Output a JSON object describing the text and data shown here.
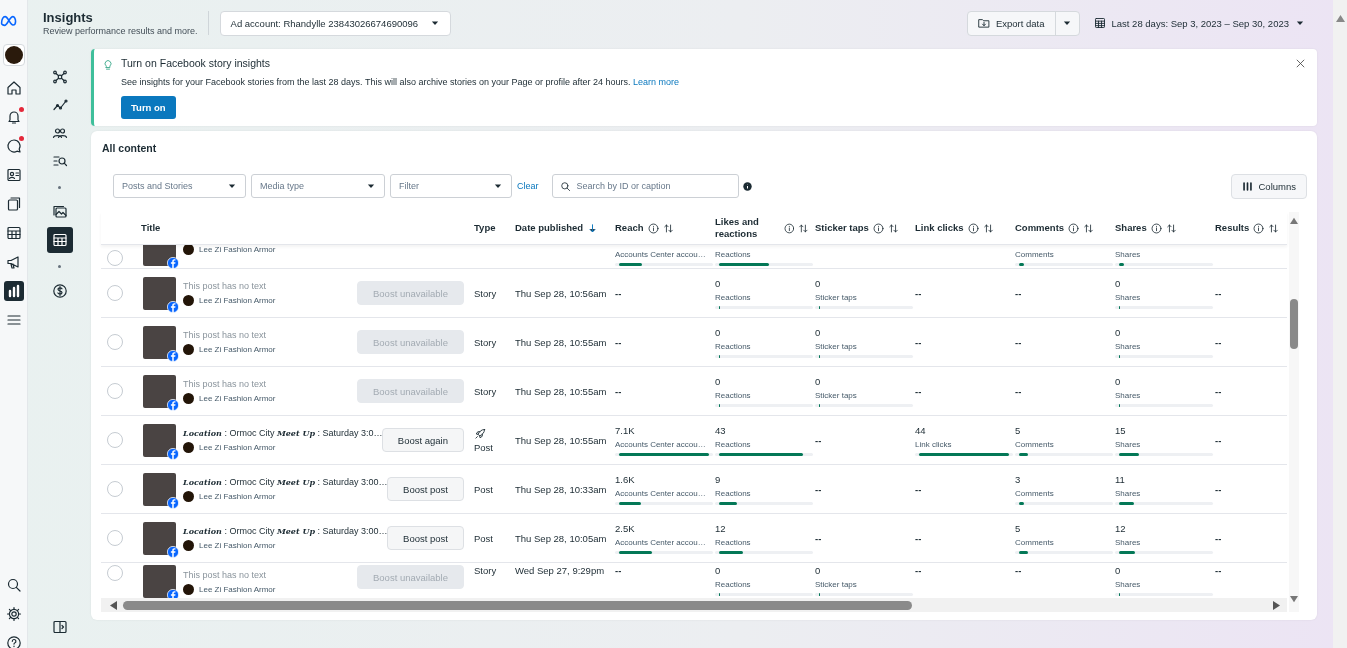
{
  "nav": {
    "items": [
      {
        "kind": "avatar",
        "selected": false,
        "badge": false
      },
      {
        "kind": "home",
        "selected": false,
        "badge": false
      },
      {
        "kind": "bell",
        "selected": false,
        "badge": true
      },
      {
        "kind": "chat",
        "selected": false,
        "badge": true
      },
      {
        "kind": "contact",
        "selected": false,
        "badge": false
      },
      {
        "kind": "pages",
        "selected": false,
        "badge": false
      },
      {
        "kind": "table",
        "selected": false,
        "badge": false
      },
      {
        "kind": "megaphone",
        "selected": false,
        "badge": false
      },
      {
        "kind": "chart",
        "selected": true,
        "badge": false
      },
      {
        "kind": "menu",
        "selected": false,
        "badge": false
      }
    ],
    "bottom_items": [
      {
        "kind": "search",
        "selected": false,
        "badge": false
      },
      {
        "kind": "settings",
        "selected": false,
        "badge": false
      },
      {
        "kind": "help",
        "selected": false,
        "badge": false
      }
    ]
  },
  "header": {
    "title": "Insights",
    "subtitle": "Review performance results and more.",
    "account": "Ad account: Rhandylle 23843026674690096",
    "export": "Export data",
    "date_range": "Last 28 days: Sep 3, 2023 – Sep 30, 2023"
  },
  "subnav": {
    "items": [
      {
        "kind": "nodes",
        "selected": false
      },
      {
        "kind": "trend",
        "selected": false
      },
      {
        "kind": "people",
        "selected": false
      },
      {
        "kind": "searchlist",
        "selected": false
      },
      {
        "kind": "dot"
      },
      {
        "kind": "gallery",
        "selected": false
      },
      {
        "kind": "table",
        "selected": true
      },
      {
        "kind": "dot"
      },
      {
        "kind": "dollar",
        "selected": false
      }
    ],
    "bottom_items": [
      {
        "kind": "panel",
        "selected": false
      }
    ]
  },
  "banner": {
    "title": "Turn on Facebook story insights",
    "text": "See insights for your Facebook stories from the last 28 days. This will also archive stories on your Page or profile after 24 hours.",
    "link": "Learn more",
    "button": "Turn on"
  },
  "content": {
    "title": "All content",
    "filters": [
      {
        "label": "Posts and Stories"
      },
      {
        "label": "Media type"
      },
      {
        "label": "Filter"
      }
    ],
    "clear": "Clear",
    "search": {
      "placeholder": "Search by ID or caption"
    },
    "columns_button": "Columns",
    "columns": [
      {
        "label": "Title",
        "info": false,
        "sortable": false,
        "sorted_desc": false
      },
      {
        "label": "Type",
        "info": false,
        "sortable": false,
        "sorted_desc": false
      },
      {
        "label": "Date published",
        "info": false,
        "sortable": false,
        "sorted_desc": true
      },
      {
        "label": "Reach",
        "info": true,
        "sortable": true,
        "sorted_desc": false
      },
      {
        "label": "Likes and reactions",
        "info": true,
        "sortable": true,
        "sorted_desc": false
      },
      {
        "label": "Sticker taps",
        "info": true,
        "sortable": true,
        "sorted_desc": false
      },
      {
        "label": "Link clicks",
        "info": true,
        "sortable": true,
        "sorted_desc": false
      },
      {
        "label": "Comments",
        "info": true,
        "sortable": true,
        "sorted_desc": false
      },
      {
        "label": "Shares",
        "info": true,
        "sortable": true,
        "sorted_desc": false
      },
      {
        "label": "Results",
        "info": true,
        "sortable": true,
        "sorted_desc": false
      }
    ],
    "rows": [
      {
        "partial": true,
        "author": "Lee Zi Fashion Armor",
        "metrics": {
          "reach": {
            "label": "Accounts Center accou…",
            "level": 0.25
          },
          "likes": {
            "label": "Reactions",
            "level": 0.55
          },
          "comments": {
            "label": "Comments",
            "level": 0.05
          },
          "shares": {
            "label": "Shares",
            "level": 0.06
          }
        }
      },
      {
        "partial": false,
        "title": "This post has no text",
        "title_muted": true,
        "author": "Lee Zi Fashion Armor",
        "boost": {
          "label": "Boost unavailable",
          "disabled": true
        },
        "type": "Story",
        "boosted": false,
        "date": "Thu Sep 28, 10:56am",
        "metrics": {
          "reach": {
            "value": "--"
          },
          "likes": {
            "value": "0",
            "label": "Reactions",
            "level": 0.01
          },
          "sticker_taps": {
            "value": "0",
            "label": "Sticker taps",
            "level": 0.01
          },
          "link_clicks": {
            "value": "--"
          },
          "comments": {
            "value": "--"
          },
          "shares": {
            "value": "0",
            "label": "Shares",
            "level": 0.01
          },
          "results": {
            "value": "--"
          }
        }
      },
      {
        "partial": false,
        "title": "This post has no text",
        "title_muted": true,
        "author": "Lee Zi Fashion Armor",
        "boost": {
          "label": "Boost unavailable",
          "disabled": true
        },
        "type": "Story",
        "boosted": false,
        "date": "Thu Sep 28, 10:55am",
        "metrics": {
          "reach": {
            "value": "--"
          },
          "likes": {
            "value": "0",
            "label": "Reactions",
            "level": 0.01
          },
          "sticker_taps": {
            "value": "0",
            "label": "Sticker taps",
            "level": 0.01
          },
          "link_clicks": {
            "value": "--"
          },
          "comments": {
            "value": "--"
          },
          "shares": {
            "value": "0",
            "label": "Shares",
            "level": 0.01
          },
          "results": {
            "value": "--"
          }
        }
      },
      {
        "partial": false,
        "title": "This post has no text",
        "title_muted": true,
        "author": "Lee Zi Fashion Armor",
        "boost": {
          "label": "Boost unavailable",
          "disabled": true
        },
        "type": "Story",
        "boosted": false,
        "date": "Thu Sep 28, 10:55am",
        "metrics": {
          "reach": {
            "value": "--"
          },
          "likes": {
            "value": "0",
            "label": "Reactions",
            "level": 0.01
          },
          "sticker_taps": {
            "value": "0",
            "label": "Sticker taps",
            "level": 0.01
          },
          "link_clicks": {
            "value": "--"
          },
          "comments": {
            "value": "--"
          },
          "shares": {
            "value": "0",
            "label": "Shares",
            "level": 0.01
          },
          "results": {
            "value": "--"
          }
        }
      },
      {
        "partial": false,
        "title": "**Location** : Ormoc City **Meet Up** : Saturday 3:0…",
        "title_muted": false,
        "author": "Lee Zi Fashion Armor",
        "boost": {
          "label": "Boost again",
          "disabled": false
        },
        "type": "Post",
        "boosted": true,
        "date": "Thu Sep 28, 10:55am",
        "metrics": {
          "reach": {
            "value": "7.1K",
            "label": "Accounts Center accou…",
            "level": 1
          },
          "likes": {
            "value": "43",
            "label": "Reactions",
            "level": 0.93
          },
          "sticker_taps": {
            "value": "--"
          },
          "link_clicks": {
            "value": "44",
            "label": "Link clicks",
            "level": 1
          },
          "comments": {
            "value": "5",
            "label": "Comments",
            "level": 0.1
          },
          "shares": {
            "value": "15",
            "label": "Shares",
            "level": 0.22
          },
          "results": {
            "value": "--"
          }
        }
      },
      {
        "partial": false,
        "title": "**Location** : Ormoc City **Meet Up** : Saturday 3:00…",
        "title_muted": false,
        "author": "Lee Zi Fashion Armor",
        "boost": {
          "label": "Boost post",
          "disabled": false
        },
        "type": "Post",
        "boosted": false,
        "date": "Thu Sep 28, 10:33am",
        "metrics": {
          "reach": {
            "value": "1.6K",
            "label": "Accounts Center accou…",
            "level": 0.24
          },
          "likes": {
            "value": "9",
            "label": "Reactions",
            "level": 0.2
          },
          "sticker_taps": {
            "value": "--"
          },
          "link_clicks": {
            "value": "--"
          },
          "comments": {
            "value": "3",
            "label": "Comments",
            "level": 0.06
          },
          "shares": {
            "value": "11",
            "label": "Shares",
            "level": 0.17
          },
          "results": {
            "value": "--"
          }
        }
      },
      {
        "partial": false,
        "title": "**Location** : Ormoc City **Meet Up** : Saturday 3:00…",
        "title_muted": false,
        "author": "Lee Zi Fashion Armor",
        "boost": {
          "label": "Boost post",
          "disabled": false
        },
        "type": "Post",
        "boosted": false,
        "date": "Thu Sep 28, 10:05am",
        "metrics": {
          "reach": {
            "value": "2.5K",
            "label": "Accounts Center accou…",
            "level": 0.37
          },
          "likes": {
            "value": "12",
            "label": "Reactions",
            "level": 0.27
          },
          "sticker_taps": {
            "value": "--"
          },
          "link_clicks": {
            "value": "--"
          },
          "comments": {
            "value": "5",
            "label": "Comments",
            "level": 0.1
          },
          "shares": {
            "value": "12",
            "label": "Shares",
            "level": 0.18
          },
          "results": {
            "value": "--"
          }
        }
      },
      {
        "partial": false,
        "title": "This post has no text",
        "title_muted": true,
        "author": "Lee Zi Fashion Armor",
        "boost": {
          "label": "Boost unavailable",
          "disabled": true
        },
        "type": "Story",
        "boosted": false,
        "date": "Wed Sep 27, 9:29pm",
        "metrics": {
          "reach": {
            "value": "--"
          },
          "likes": {
            "value": "0",
            "label": "Reactions",
            "level": 0.01
          },
          "sticker_taps": {
            "value": "0",
            "label": "Sticker taps",
            "level": 0.01
          },
          "link_clicks": {
            "value": "--"
          },
          "comments": {
            "value": "--"
          },
          "shares": {
            "value": "0",
            "label": "Shares",
            "level": 0.01
          },
          "results": {
            "value": "--"
          }
        }
      }
    ]
  }
}
